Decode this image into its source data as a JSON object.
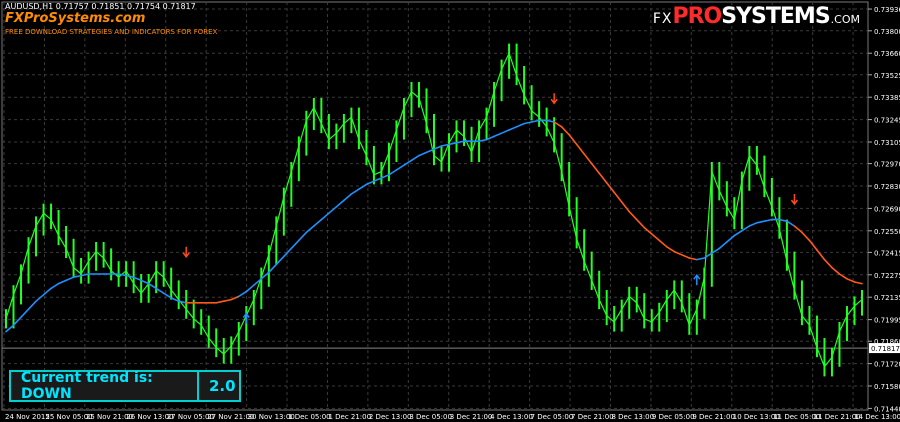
{
  "header": {
    "symbol_line": "AUDUSD,H1  0.71757 0.71851 0.71754 0.71817",
    "site_name": "FXProSystems.com",
    "tagline": "FREE DOWNLOAD STRATEGIES AND INDICATORS FOR FOREX"
  },
  "logo": {
    "fx": "FX",
    "pro": "PRO",
    "systems": "SYSTEMS",
    "com": ".COM"
  },
  "trend_panel": {
    "label": "Current trend is: DOWN",
    "value": "2.0"
  },
  "colors": {
    "background": "#000000",
    "grid": "#3a3a3a",
    "price": "#22ff22",
    "ma_up": "#1e90ff",
    "ma_down": "#ff5a1a",
    "arrow_up": "#1e90ff",
    "arrow_down": "#ff4a1a",
    "axis_text": "#ffffff",
    "panel_border": "#00d0d0"
  },
  "chart_data": {
    "type": "line",
    "symbol": "AUDUSD",
    "timeframe": "H1",
    "current_price": 0.71817,
    "ylim": [
      0.7143,
      0.7398
    ],
    "y_ticks": [
      0.73936,
      0.738,
      0.7366,
      0.73525,
      0.73385,
      0.73245,
      0.73105,
      0.7297,
      0.7283,
      0.7269,
      0.7255,
      0.72415,
      0.72275,
      0.72135,
      0.71995,
      0.7186,
      0.7172,
      0.7158,
      0.7144
    ],
    "x_ticks": [
      "24 Nov 2015",
      "25 Nov 05:00",
      "25 Nov 21:00",
      "26 Nov 13:00",
      "27 Nov 05:00",
      "27 Nov 21:00",
      "30 Nov 13:00",
      "1 Dec 05:00",
      "1 Dec 21:00",
      "2 Dec 13:00",
      "3 Dec 05:00",
      "3 Dec 21:00",
      "4 Dec 13:00",
      "7 Dec 05:00",
      "7 Dec 21:00",
      "8 Dec 13:00",
      "9 Dec 05:00",
      "9 Dec 21:00",
      "10 Dec 13:00",
      "11 Dec 05:00",
      "11 Dec 21:00",
      "14 Dec 13:00"
    ],
    "grid": true,
    "series": [
      {
        "role": "price",
        "values": [
          0.72,
          0.7215,
          0.7228,
          0.7245,
          0.7258,
          0.7266,
          0.7262,
          0.7252,
          0.7244,
          0.7232,
          0.7228,
          0.7236,
          0.7242,
          0.7238,
          0.723,
          0.7226,
          0.723,
          0.7222,
          0.7216,
          0.7222,
          0.723,
          0.7226,
          0.7218,
          0.7212,
          0.7206,
          0.72,
          0.7196,
          0.7188,
          0.7182,
          0.7178,
          0.7183,
          0.7192,
          0.7202,
          0.7212,
          0.7226,
          0.724,
          0.7258,
          0.7276,
          0.7292,
          0.7308,
          0.7324,
          0.7332,
          0.7322,
          0.7312,
          0.7316,
          0.7322,
          0.7326,
          0.7312,
          0.7302,
          0.729,
          0.7292,
          0.7304,
          0.7318,
          0.7332,
          0.7342,
          0.7338,
          0.7322,
          0.7302,
          0.7298,
          0.731,
          0.7318,
          0.7314,
          0.7304,
          0.7318,
          0.7326,
          0.7342,
          0.7356,
          0.7366,
          0.7352,
          0.734,
          0.733,
          0.7326,
          0.732,
          0.731,
          0.7292,
          0.727,
          0.725,
          0.7236,
          0.7224,
          0.7212,
          0.7202,
          0.7198,
          0.7206,
          0.7214,
          0.721,
          0.72,
          0.7198,
          0.7204,
          0.7212,
          0.7218,
          0.721,
          0.7196,
          0.7206,
          0.7226,
          0.7292,
          0.728,
          0.727,
          0.7262,
          0.7286,
          0.7302,
          0.7296,
          0.7282,
          0.727,
          0.7256,
          0.7236,
          0.7218,
          0.7202,
          0.7196,
          0.7182,
          0.717,
          0.7176,
          0.7192,
          0.7202,
          0.7208,
          0.7212
        ]
      },
      {
        "role": "moving_average",
        "values": [
          0.7192,
          0.7196,
          0.7201,
          0.7206,
          0.7211,
          0.7215,
          0.7219,
          0.7222,
          0.7224,
          0.7226,
          0.7227,
          0.7228,
          0.7228,
          0.7228,
          0.7228,
          0.7228,
          0.7227,
          0.7226,
          0.7224,
          0.7222,
          0.7219,
          0.7216,
          0.7213,
          0.7211,
          0.721,
          0.721,
          0.721,
          0.721,
          0.721,
          0.7211,
          0.7212,
          0.7214,
          0.7217,
          0.7221,
          0.7225,
          0.7229,
          0.7234,
          0.7239,
          0.7244,
          0.7249,
          0.7254,
          0.7258,
          0.7262,
          0.7266,
          0.727,
          0.7274,
          0.7278,
          0.7281,
          0.7284,
          0.7286,
          0.7288,
          0.729,
          0.7293,
          0.7296,
          0.7299,
          0.7302,
          0.7304,
          0.7306,
          0.7308,
          0.7309,
          0.731,
          0.7311,
          0.7311,
          0.7311,
          0.7312,
          0.7314,
          0.7316,
          0.7318,
          0.732,
          0.7322,
          0.7323,
          0.7324,
          0.7324,
          0.7323,
          0.732,
          0.7315,
          0.7309,
          0.7303,
          0.7297,
          0.7291,
          0.7285,
          0.7279,
          0.7273,
          0.7267,
          0.7262,
          0.7257,
          0.7253,
          0.7249,
          0.7245,
          0.7242,
          0.724,
          0.7238,
          0.7237,
          0.7238,
          0.7241,
          0.7244,
          0.7248,
          0.7252,
          0.7255,
          0.7258,
          0.726,
          0.7261,
          0.7262,
          0.7262,
          0.7261,
          0.7258,
          0.7254,
          0.7249,
          0.7243,
          0.7237,
          0.7232,
          0.7228,
          0.7225,
          0.7223,
          0.7222
        ],
        "down_ranges": [
          [
            24,
            31
          ],
          [
            73,
            92
          ],
          [
            105,
            114
          ]
        ]
      }
    ],
    "signals": [
      {
        "type": "down",
        "index": 24,
        "price": 0.7235
      },
      {
        "type": "up",
        "index": 32,
        "price": 0.7207
      },
      {
        "type": "down",
        "index": 73,
        "price": 0.7331
      },
      {
        "type": "up",
        "index": 92,
        "price": 0.7231
      },
      {
        "type": "down",
        "index": 105,
        "price": 0.7268
      }
    ]
  }
}
